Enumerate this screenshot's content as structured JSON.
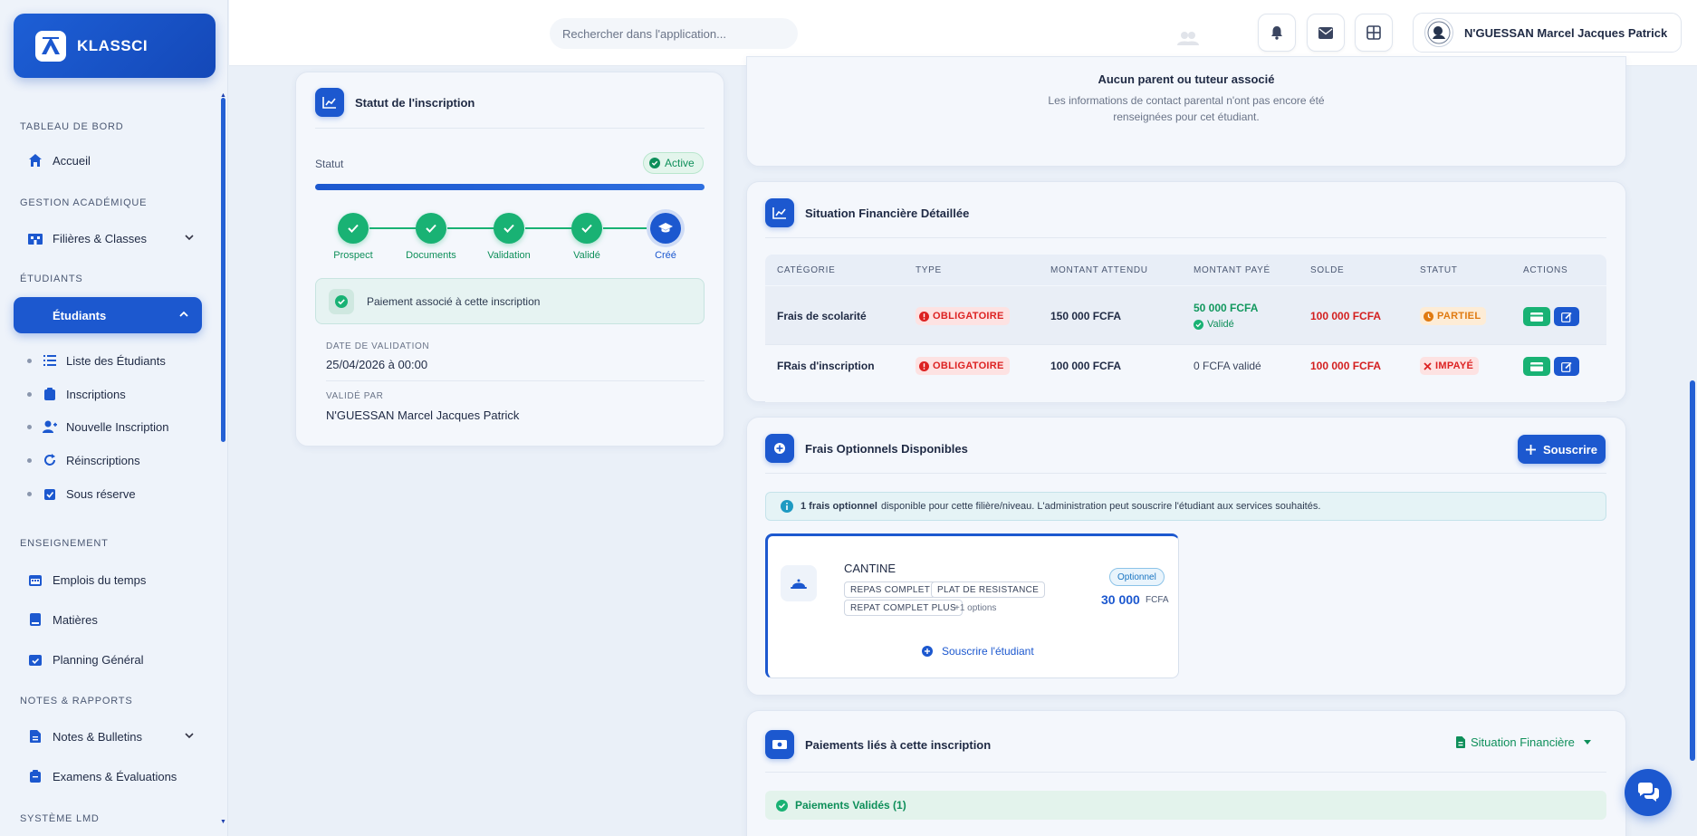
{
  "app": {
    "name": "KLASSCI"
  },
  "sidebar": {
    "sections": {
      "dashboard": "TABLEAU DE BORD",
      "academic": "GESTION ACADÉMIQUE",
      "students": "ÉTUDIANTS",
      "teaching": "ENSEIGNEMENT",
      "notes": "NOTES & RAPPORTS",
      "lmd": "SYSTÈME LMD"
    },
    "items": {
      "home": "Accueil",
      "filieres": "Filières & Classes",
      "students": "Étudiants",
      "schedule": "Emplois du temps",
      "subjects": "Matières",
      "planning": "Planning Général",
      "bulletins": "Notes & Bulletins",
      "exams": "Examens & Évaluations"
    },
    "sub_items": {
      "list": "Liste des Étudiants",
      "inscriptions": "Inscriptions",
      "new": "Nouvelle Inscription",
      "reinscriptions": "Réinscriptions",
      "reserve": "Sous réserve"
    }
  },
  "topbar": {
    "search_placeholder": "Rechercher dans l'application...",
    "user_name": "N'GUESSAN Marcel Jacques Patrick"
  },
  "status_card": {
    "title": "Statut de l'inscription",
    "status_label": "Statut",
    "status_value": "Active",
    "progress": 1.0,
    "steps": [
      "Prospect",
      "Documents",
      "Validation",
      "Validé",
      "Créé"
    ],
    "payment_note": "Paiement associé à cette inscription",
    "validation_date_label": "DATE DE VALIDATION",
    "validation_date": "25/04/2026 à 00:00",
    "validated_by_label": "VALIDÉ PAR",
    "validated_by": "N'GUESSAN Marcel Jacques Patrick"
  },
  "parent_card": {
    "title": "Aucun parent ou tuteur associé",
    "description": "Les informations de contact parental n'ont pas encore été renseignées pour cet étudiant."
  },
  "finance": {
    "title": "Situation Financière Détaillée",
    "headers": [
      "CATÉGORIE",
      "TYPE",
      "MONTANT ATTENDU",
      "MONTANT PAYÉ",
      "SOLDE",
      "STATUT",
      "ACTIONS"
    ],
    "rows": [
      {
        "category": "Frais de scolarité",
        "type": "OBLIGATOIRE",
        "expected": "150 000 FCFA",
        "paid": "50 000 FCFA",
        "paid_note": "Validé",
        "balance": "100 000 FCFA",
        "status": "PARTIEL"
      },
      {
        "category": "FRais d'inscription",
        "type": "OBLIGATOIRE",
        "expected": "100 000 FCFA",
        "paid": "0 FCFA validé",
        "paid_note": "",
        "balance": "100 000 FCFA",
        "status": "IMPAYÉ"
      }
    ],
    "colors": {
      "danger": "#d41f1f",
      "success": "#12985e",
      "warning": "#e07a10"
    }
  },
  "optional": {
    "title": "Frais Optionnels Disponibles",
    "subscribe_label": "Souscrire",
    "info_bold": "1 frais optionnel",
    "info_rest": "disponible pour cette filière/niveau. L'administration peut souscrire l'étudiant aux services souhaités.",
    "service": {
      "name": "CANTINE",
      "badge": "Optionnel",
      "tags": [
        "REPAS COMPLET",
        "PLAT DE RESISTANCE",
        "REPAT COMPLET PLUS"
      ],
      "more": "+1 options",
      "price": "30 000",
      "currency": "FCFA",
      "action": "Souscrire l'étudiant"
    }
  },
  "payments": {
    "title": "Paiements liés à cette inscription",
    "dropdown": "Situation Financière",
    "validated": "Paiements Validés (1)"
  },
  "icons": [
    "home-icon",
    "building-icon",
    "list-icon",
    "clipboard-icon",
    "user-plus-icon",
    "refresh-icon",
    "clipboard-check-icon",
    "calendar-icon",
    "book-icon",
    "calendar-check-icon",
    "file-icon",
    "bell-icon",
    "mail-icon",
    "grid-icon",
    "chart-icon",
    "plus-circle-icon",
    "cloche-icon",
    "money-icon",
    "chat-icon"
  ]
}
